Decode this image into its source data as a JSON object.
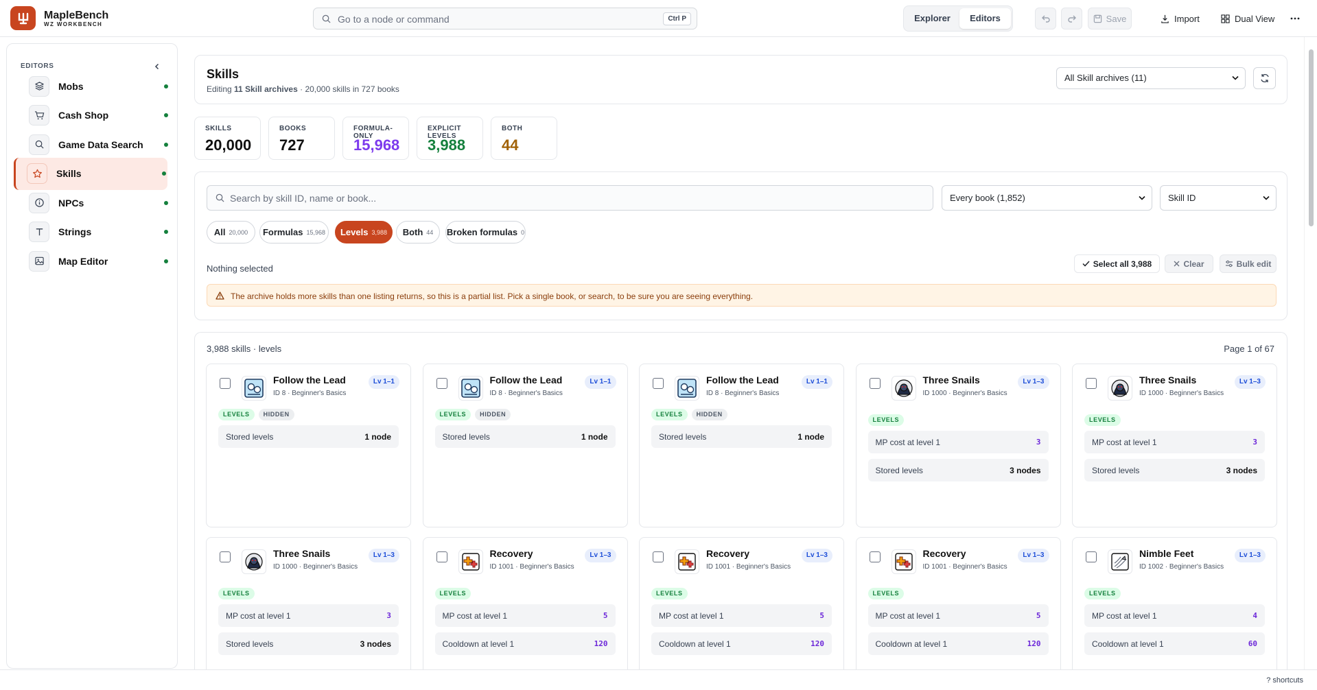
{
  "app": {
    "name": "MapleBench",
    "subtitle": "WZ WORKBENCH"
  },
  "command": {
    "placeholder": "Go to a node or command",
    "shortcut": "Ctrl P"
  },
  "mode": {
    "explorer": "Explorer",
    "editors": "Editors",
    "active": "Editors"
  },
  "toolbar": {
    "save": "Save",
    "import": "Import",
    "dual_view": "Dual View"
  },
  "sidebar": {
    "title": "EDITORS",
    "items": [
      {
        "label": "Mobs",
        "icon": "layers-icon",
        "active": false
      },
      {
        "label": "Cash Shop",
        "icon": "cart-icon",
        "active": false
      },
      {
        "label": "Game Data Search",
        "icon": "search-icon",
        "active": false
      },
      {
        "label": "Skills",
        "icon": "star-icon",
        "active": true
      },
      {
        "label": "NPCs",
        "icon": "info-icon",
        "active": false
      },
      {
        "label": "Strings",
        "icon": "text-icon",
        "active": false
      },
      {
        "label": "Map Editor",
        "icon": "image-icon",
        "active": false
      }
    ]
  },
  "header": {
    "title": "Skills",
    "sub_prefix": "Editing ",
    "sub_bold": "11 Skill archives",
    "sub_suffix": " · 20,000 skills in 727 books",
    "archive_select": "All Skill archives (11)"
  },
  "stats": [
    {
      "label": "SKILLS",
      "value": "20,000",
      "color": "#111111"
    },
    {
      "label": "BOOKS",
      "value": "727",
      "color": "#111111"
    },
    {
      "label": "FORMULA-ONLY",
      "value": "15,968",
      "color": "#7c3aed"
    },
    {
      "label": "EXPLICIT LEVELS",
      "value": "3,988",
      "color": "#15803d"
    },
    {
      "label": "BOTH",
      "value": "44",
      "color": "#a16207"
    }
  ],
  "filters": {
    "search_placeholder": "Search by skill ID, name or book...",
    "book_select": "Every book (1,852)",
    "sort_select": "Skill ID",
    "pills": [
      {
        "label": "All",
        "count": "20,000"
      },
      {
        "label": "Formulas",
        "count": "15,968"
      },
      {
        "label": "Levels",
        "count": "3,988",
        "active": true
      },
      {
        "label": "Both",
        "count": "44"
      },
      {
        "label": "Broken formulas",
        "count": "0"
      }
    ],
    "selection": "Nothing selected",
    "select_all": "Select all 3,988",
    "clear": "Clear",
    "bulk_edit": "Bulk edit",
    "warning": "The archive holds more skills than one listing returns, so this is a partial list. Pick a single book, or search, to be sure you are seeing everything."
  },
  "results": {
    "count_label": "3,988 skills · levels",
    "page": "Page 1 of 67",
    "cards": [
      {
        "name": "Follow the Lead",
        "meta": "ID 8 · Beginner's Basics",
        "level": "Lv 1–1",
        "icon": "follow-lead",
        "tags": [
          "LEVELS",
          "HIDDEN"
        ],
        "rows": [
          {
            "label": "Stored levels",
            "value": "1 node",
            "mono": false
          }
        ]
      },
      {
        "name": "Follow the Lead",
        "meta": "ID 8 · Beginner's Basics",
        "level": "Lv 1–1",
        "icon": "follow-lead",
        "tags": [
          "LEVELS",
          "HIDDEN"
        ],
        "rows": [
          {
            "label": "Stored levels",
            "value": "1 node",
            "mono": false
          }
        ]
      },
      {
        "name": "Follow the Lead",
        "meta": "ID 8 · Beginner's Basics",
        "level": "Lv 1–1",
        "icon": "follow-lead",
        "tags": [
          "LEVELS",
          "HIDDEN"
        ],
        "rows": [
          {
            "label": "Stored levels",
            "value": "1 node",
            "mono": false
          }
        ]
      },
      {
        "name": "Three Snails",
        "meta": "ID 1000 · Beginner's Basics",
        "level": "Lv 1–3",
        "icon": "three-snails",
        "tags": [
          "LEVELS"
        ],
        "rows": [
          {
            "label": "MP cost at level 1",
            "value": "3",
            "mono": true
          },
          {
            "label": "Stored levels",
            "value": "3 nodes",
            "mono": false
          }
        ]
      },
      {
        "name": "Three Snails",
        "meta": "ID 1000 · Beginner's Basics",
        "level": "Lv 1–3",
        "icon": "three-snails",
        "tags": [
          "LEVELS"
        ],
        "rows": [
          {
            "label": "MP cost at level 1",
            "value": "3",
            "mono": true
          },
          {
            "label": "Stored levels",
            "value": "3 nodes",
            "mono": false
          }
        ]
      },
      {
        "name": "Three Snails",
        "meta": "ID 1000 · Beginner's Basics",
        "level": "Lv 1–3",
        "icon": "three-snails",
        "tags": [
          "LEVELS"
        ],
        "rows": [
          {
            "label": "MP cost at level 1",
            "value": "3",
            "mono": true
          },
          {
            "label": "Stored levels",
            "value": "3 nodes",
            "mono": false
          }
        ]
      },
      {
        "name": "Recovery",
        "meta": "ID 1001 · Beginner's Basics",
        "level": "Lv 1–3",
        "icon": "recovery",
        "tags": [
          "LEVELS"
        ],
        "rows": [
          {
            "label": "MP cost at level 1",
            "value": "5",
            "mono": true
          },
          {
            "label": "Cooldown at level 1",
            "value": "120",
            "mono": true
          }
        ]
      },
      {
        "name": "Recovery",
        "meta": "ID 1001 · Beginner's Basics",
        "level": "Lv 1–3",
        "icon": "recovery",
        "tags": [
          "LEVELS"
        ],
        "rows": [
          {
            "label": "MP cost at level 1",
            "value": "5",
            "mono": true
          },
          {
            "label": "Cooldown at level 1",
            "value": "120",
            "mono": true
          }
        ]
      },
      {
        "name": "Recovery",
        "meta": "ID 1001 · Beginner's Basics",
        "level": "Lv 1–3",
        "icon": "recovery",
        "tags": [
          "LEVELS"
        ],
        "rows": [
          {
            "label": "MP cost at level 1",
            "value": "5",
            "mono": true
          },
          {
            "label": "Cooldown at level 1",
            "value": "120",
            "mono": true
          }
        ]
      },
      {
        "name": "Nimble Feet",
        "meta": "ID 1002 · Beginner's Basics",
        "level": "Lv 1–3",
        "icon": "nimble-feet",
        "tags": [
          "LEVELS"
        ],
        "rows": [
          {
            "label": "MP cost at level 1",
            "value": "4",
            "mono": true
          },
          {
            "label": "Cooldown at level 1",
            "value": "60",
            "mono": true
          }
        ]
      }
    ]
  },
  "footer": {
    "shortcuts": "? shortcuts"
  },
  "colors": {
    "accent": "#c8451f",
    "accent_soft": "#fde9e4",
    "ok": "#15803d",
    "warn_bg": "#fff4e5"
  }
}
